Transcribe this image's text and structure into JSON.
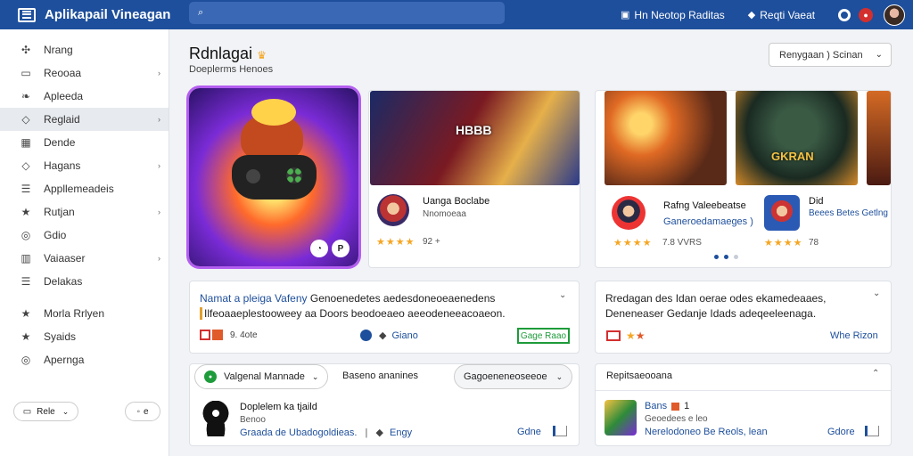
{
  "app": {
    "title": "Aplikapail Vineagan"
  },
  "search": {
    "placeholder": ""
  },
  "topbar": {
    "link1": "Hn Neotop Raditas",
    "link2": "Reqti Vaeat"
  },
  "sidebar": {
    "items": [
      {
        "label": "Nrang",
        "icon": "puzzle-icon",
        "glyph": "✣"
      },
      {
        "label": "Reooaa",
        "icon": "inbox-icon",
        "glyph": "▭",
        "chevron": true
      },
      {
        "label": "Apleeda",
        "icon": "leaf-icon",
        "glyph": "❧"
      },
      {
        "label": "Reglaid",
        "icon": "tag-icon",
        "glyph": "◇",
        "chevron": true,
        "active": true
      },
      {
        "label": "Dende",
        "icon": "grid-icon",
        "glyph": "▦"
      },
      {
        "label": "Hagans",
        "icon": "tag-icon",
        "glyph": "◇",
        "chevron": true
      },
      {
        "label": "Appllemeadeis",
        "icon": "list-icon",
        "glyph": "☰"
      },
      {
        "label": "Rutjan",
        "icon": "star-icon",
        "glyph": "★",
        "chevron": true
      },
      {
        "label": "Gdio",
        "icon": "pin-icon",
        "glyph": "◎"
      },
      {
        "label": "Vaiaaser",
        "icon": "chart-icon",
        "glyph": "▥",
        "chevron": true
      },
      {
        "label": "Delakas",
        "icon": "list-icon",
        "glyph": "☰"
      },
      {
        "label": "Morla Rrlyen",
        "icon": "star-icon",
        "glyph": "★"
      },
      {
        "label": "Syaids",
        "icon": "star-icon",
        "glyph": "★"
      },
      {
        "label": "Apernga",
        "icon": "pin-icon",
        "glyph": "◎"
      }
    ],
    "btn1": "Rele",
    "btn2": "e"
  },
  "main": {
    "title": "Rdnlagai",
    "subtitle": "Doeplerms Henoes",
    "sort": "Renygaan ) Scinan"
  },
  "featured": {
    "card1": {
      "title": "Uanga Boclabe",
      "sub": "Nnomoeaa",
      "stars": "★★★★",
      "rating": "92 +",
      "banner": "HBBB"
    },
    "card2": {
      "title": "Rafng Valeebeatse",
      "sub": "Ganeroedamaeges )",
      "stars": "★★★★",
      "rating": "7.8 VVRS",
      "banner": "GKRAN"
    },
    "card3": {
      "title": "Did",
      "sub": "Beees Betes Getlng",
      "stars": "★★★★",
      "rating": "78"
    }
  },
  "row2": {
    "left": {
      "title": "Namat a pleiga Vafeny",
      "text1": "Genoenedetes aedesdoneoeaenedens",
      "text2": "Ilfeoaaeplestooweey aa Doors beodoeaeo aeeodeneeacoaeon.",
      "meta": "9. 4ote",
      "link": "Giano",
      "button": "Gage Raao"
    },
    "right": {
      "text1": "Rredagan des Idan oerae odes ekamedeaaes,",
      "text2": "Deneneaser Gedanje Idads adeqeeleenaga.",
      "link": "Whe Rizon"
    }
  },
  "filters": {
    "pill1": "Valgenal Mannade",
    "label": "Baseno ananines",
    "pill2": "Gagoeneneoseeoe"
  },
  "bottom": {
    "left": {
      "title": "Doplelem ka tjaild",
      "sub": "Benoo",
      "detail": "Graada de Ubadogoldieas.",
      "link": "Engy",
      "action": "Gdne"
    },
    "right": {
      "header": "Repitsaeooana",
      "title": "Bans",
      "count": "1",
      "sub": "Geoedees e leo",
      "detail": "Nerelodoneo Be Reols, lean",
      "action": "Gdore"
    }
  },
  "colors": {
    "topbar": "#1e4f9c",
    "accent": "#1e4f9c",
    "green": "#1e9b3a",
    "star": "#f5a623"
  }
}
